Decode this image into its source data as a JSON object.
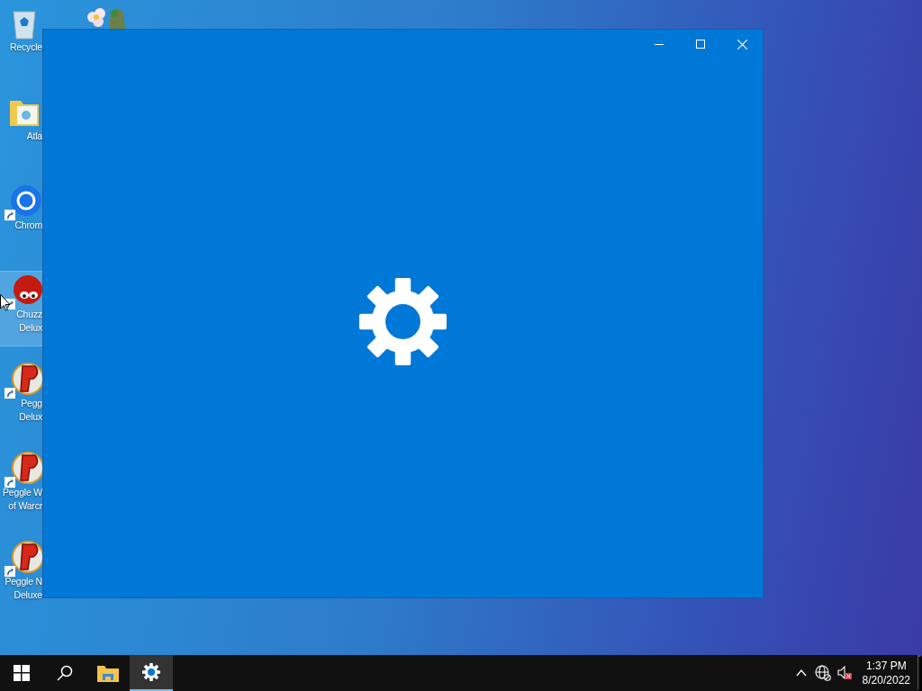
{
  "desktop": {
    "icons": [
      {
        "kind": "recycle",
        "lines": [
          "Recycle"
        ],
        "selected": false,
        "shortcut": false
      },
      {
        "kind": "folder",
        "lines": [
          "Atla"
        ],
        "selected": false,
        "shortcut": false
      },
      {
        "kind": "chrome",
        "lines": [
          "Chrom"
        ],
        "selected": false,
        "shortcut": true
      },
      {
        "kind": "chuzzle",
        "lines": [
          "Chuzz",
          "Delux"
        ],
        "selected": true,
        "shortcut": true
      },
      {
        "kind": "peggle",
        "lines": [
          "Pegg",
          "Delux"
        ],
        "selected": false,
        "shortcut": true
      },
      {
        "kind": "peggle",
        "lines": [
          "Peggle W",
          "of Warcr"
        ],
        "selected": false,
        "shortcut": true
      },
      {
        "kind": "peggle",
        "lines": [
          "Peggle N",
          "Deluxe"
        ],
        "selected": false,
        "shortcut": true
      }
    ]
  },
  "window": {
    "loading": true
  },
  "taskbar": {
    "apps": [
      {
        "kind": "start",
        "active": false
      },
      {
        "kind": "search",
        "active": false
      },
      {
        "kind": "explorer",
        "active": false
      },
      {
        "kind": "settings",
        "active": true
      }
    ],
    "tray": [
      {
        "kind": "chevron"
      },
      {
        "kind": "network"
      },
      {
        "kind": "volume"
      }
    ],
    "clock": {
      "time": "1:37 PM",
      "date": "8/20/2022"
    }
  }
}
